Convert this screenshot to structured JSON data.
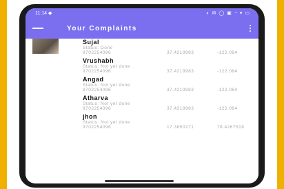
{
  "status_bar": {
    "time": "11:14 ◆",
    "indicators": "◐ ✉ ◯ ▣ ◔ ▾ ▭"
  },
  "app_bar": {
    "title": "Your Complaints"
  },
  "complaints": [
    {
      "name": "Sujal",
      "status": "Status: Done",
      "phone": "9702254096",
      "lat": "37.4219983",
      "lng": "-122.084",
      "has_thumb": true
    },
    {
      "name": "Vrushabh",
      "status": "Status: Not yet done",
      "phone": "9702254096",
      "lat": "37.4219983",
      "lng": "-122.084",
      "has_thumb": false
    },
    {
      "name": "Angad",
      "status": "Status: Not yet done",
      "phone": "9702254096",
      "lat": "37.4219983",
      "lng": "-122.084",
      "has_thumb": false
    },
    {
      "name": "Atharva",
      "status": "Status: Not yet done",
      "phone": "9702254096",
      "lat": "37.4219983",
      "lng": "-122.084",
      "has_thumb": false
    },
    {
      "name": "jhon",
      "status": "Status: Not yet done",
      "phone": "9702254096",
      "lat": "17.3850271",
      "lng": "78.4267518",
      "has_thumb": false
    }
  ],
  "colors": {
    "accent": "#7b6ff0",
    "frame": "#f0b000"
  }
}
